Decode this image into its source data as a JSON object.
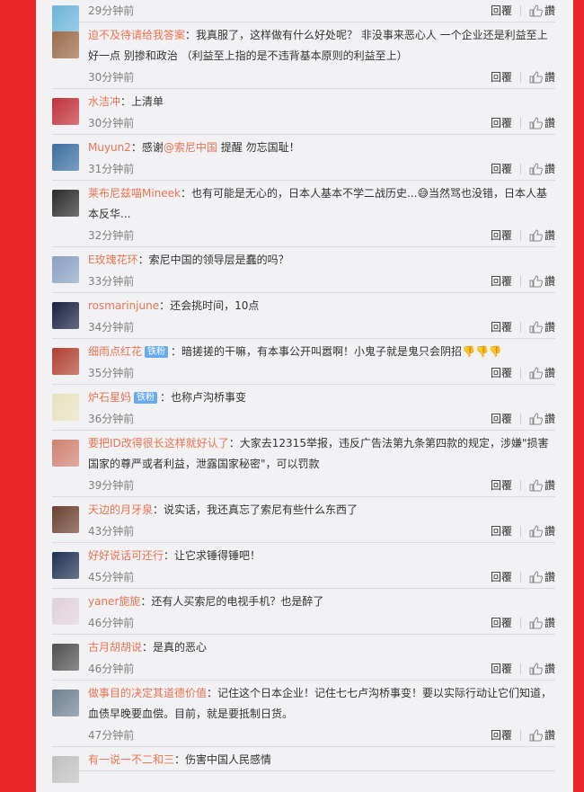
{
  "reply_label": "回覆",
  "like_label": "讚",
  "comments": [
    {
      "user": "",
      "badge": "",
      "text": "",
      "time": "29分钟前",
      "avatar": "#6ab4d8",
      "lines": 0
    },
    {
      "user": "迫不及待请给我答案",
      "badge": "",
      "text": "：我真服了，这样做有什么好处呢？ 非没事来恶心人 一个企业还是利益至上好一点 别掺和政治 （利益至上指的是不违背基本原则的利益至上）",
      "time": "30分钟前",
      "avatar": "#9a6a4a"
    },
    {
      "user": "水洁冲",
      "badge": "",
      "text": "：上清单",
      "time": "30分钟前",
      "avatar": "#c0303a"
    },
    {
      "user": "Muyun2",
      "badge": "",
      "text_pre": "：感谢",
      "mention": "@索尼中国",
      "text": " 提醒 勿忘国耻！",
      "time": "31分钟前",
      "avatar": "#3a6ea0"
    },
    {
      "user": "莱布尼兹喵Mineek",
      "badge": "",
      "text": "：也有可能是无心的，日本人基本不学二战历史...😅当然骂也没错，日本人基本反华...",
      "time": "32分钟前",
      "avatar": "#2a2a2a"
    },
    {
      "user": "E玫瑰花环",
      "badge": "",
      "text": "：索尼中国的领导层是蠢的吗？",
      "time": "33分钟前",
      "avatar": "#8aa0c0"
    },
    {
      "user": "rosmarinjune",
      "badge": "",
      "text": "：还会挑时间，10点",
      "time": "34分钟前",
      "avatar": "#1a2040"
    },
    {
      "user": "细雨点红花",
      "badge": "铁粉",
      "text": "：暗搓搓的干嘛，有本事公开叫嚣啊！小鬼子就是鬼只会阴招👎👎👎",
      "time": "35分钟前",
      "avatar": "#b04030"
    },
    {
      "user": "炉石星妈",
      "badge": "铁粉",
      "text": "：也称卢沟桥事变",
      "time": "36分钟前",
      "avatar": "#e8e0c0"
    },
    {
      "user": "要把ID改得很长这样就好认了",
      "badge": "",
      "text": "：大家去12315举报，违反广告法第九条第四款的规定，涉嫌\"损害国家的尊严或者利益，泄露国家秘密\"，可以罚款",
      "time": "39分钟前",
      "avatar": "#d08070"
    },
    {
      "user": "天边的月牙泉",
      "badge": "",
      "text": "：说实话，我还真忘了索尼有些什么东西了",
      "time": "43分钟前",
      "avatar": "#6a4030"
    },
    {
      "user": "好好说话可还行",
      "badge": "",
      "text": "：让它求锤得锤吧！",
      "time": "45分钟前",
      "avatar": "#203050"
    },
    {
      "user": "yaner旎旎",
      "badge": "",
      "text": "：还有人买索尼的电视手机？也是醉了",
      "time": "46分钟前",
      "avatar": "#e0d0d8"
    },
    {
      "user": "古月胡胡说",
      "badge": "",
      "text": "：是真的恶心",
      "time": "46分钟前",
      "avatar": "#505050"
    },
    {
      "user": "做事目的决定其道德价值",
      "badge": "",
      "text": "：记住这个日本企业！记住七七卢沟桥事变！要以实际行动让它们知道，血债早晚要血偿。目前，就是要抵制日货。",
      "time": "47分钟前",
      "avatar": "#708090"
    },
    {
      "user": "有一说一不二和三",
      "badge": "",
      "text": "：伤害中国人民感情",
      "time": "",
      "avatar": "#c0c0c0"
    }
  ]
}
